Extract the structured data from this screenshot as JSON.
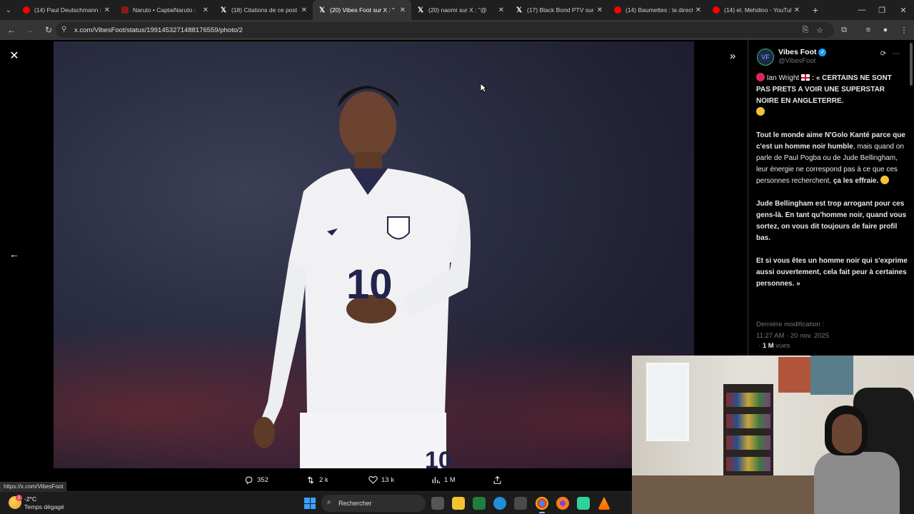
{
  "browser": {
    "tabs": [
      {
        "label": "(14) Paul Deutschmann : ",
        "favicon": "youtube-icon",
        "active": false
      },
      {
        "label": "Naruto • CaptaiNaruto : ",
        "favicon": "twitch-icon",
        "active": false
      },
      {
        "label": "(18) Citations de ce post",
        "favicon": "x-icon",
        "active": false
      },
      {
        "label": "(20) Vibes Foot sur X : \"",
        "favicon": "x-icon",
        "active": true
      },
      {
        "label": "(20) naomi sur X : \"@",
        "favicon": "x-icon",
        "active": false
      },
      {
        "label": "(17) Black Bond PTV sur X",
        "favicon": "x-icon",
        "active": false
      },
      {
        "label": "(14) Baumettes : la directi",
        "favicon": "youtube-icon",
        "active": false
      },
      {
        "label": "(14) el. Mehdino - YouTub",
        "favicon": "youtube-icon",
        "active": false
      }
    ],
    "url": "x.com/VibesFoot/status/1991453271488176559/photo/2"
  },
  "post": {
    "display_name": "Vibes Foot",
    "handle": "@VibesFoot",
    "avatar_text": "VF",
    "line1_name": " Ian Wright ",
    "line1_bold": " : « CERTAINS NE SONT PAS PRETS A VOIR UNE SUPERSTAR NOIRE EN ANGLETERRE.",
    "p2_a": "Tout le monde aime N'Golo Kanté parce que c'est un homme noir ",
    "p2_b": "humble",
    "p2_c": ", mais quand on parle de Paul Pogba ou de Jude Bellingham, leur énergie ne correspond pas à ce que ces personnes recherchent, ",
    "p2_d": "ça les effraie.",
    "p3": "Jude Bellingham est trop arrogant pour ces gens-là. En tant qu'homme noir, quand vous sortez, on vous dit toujours de faire profil bas.",
    "p4": "Et si vous êtes un homme noir qui s'exprime aussi ouvertement, cela fait peur à certaines personnes. »",
    "last_modified_label": "Dernière modification :",
    "timestamp": "11:27 AM · 20 nov. 2025",
    "views_count": "1 M",
    "views_label": " vues"
  },
  "actions": {
    "replies": "352",
    "reposts": "2 k",
    "likes": "13 k",
    "views": "1 M"
  },
  "status_url": "https://x.com/VibesFoot",
  "taskbar": {
    "weather_badge": "2",
    "temperature": "-2°C",
    "condition": "Temps dégagé",
    "search_placeholder": "Rechercher"
  },
  "colors": {
    "accent_blue": "#1d9bf0",
    "background": "#000000",
    "muted_text": "#71767b"
  }
}
